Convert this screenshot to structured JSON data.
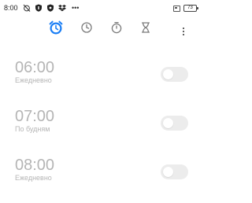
{
  "status_bar": {
    "time": "8:00",
    "dots": "•••",
    "battery": "73",
    "icons_left": [
      "alarm-off-icon",
      "shield-icon",
      "shield-check-icon",
      "dropbox-icon"
    ],
    "icons_right": [
      "sim-icon",
      "battery-icon"
    ]
  },
  "tabs": [
    {
      "name": "alarm",
      "icon": "alarm-clock-icon",
      "active": true
    },
    {
      "name": "clock",
      "icon": "clock-icon",
      "active": false
    },
    {
      "name": "stopwatch",
      "icon": "stopwatch-icon",
      "active": false
    },
    {
      "name": "timer",
      "icon": "hourglass-icon",
      "active": false
    }
  ],
  "colors": {
    "accent": "#1a7ef5",
    "inactive_icon": "#7a7a7a",
    "disabled_text": "#b5b5b5",
    "toggle_off": "#ececec"
  },
  "alarms": [
    {
      "time": "06:00",
      "repeat": "Ежедневно",
      "enabled": false
    },
    {
      "time": "07:00",
      "repeat": "По будням",
      "enabled": false
    },
    {
      "time": "08:00",
      "repeat": "Ежедневно",
      "enabled": false
    }
  ]
}
